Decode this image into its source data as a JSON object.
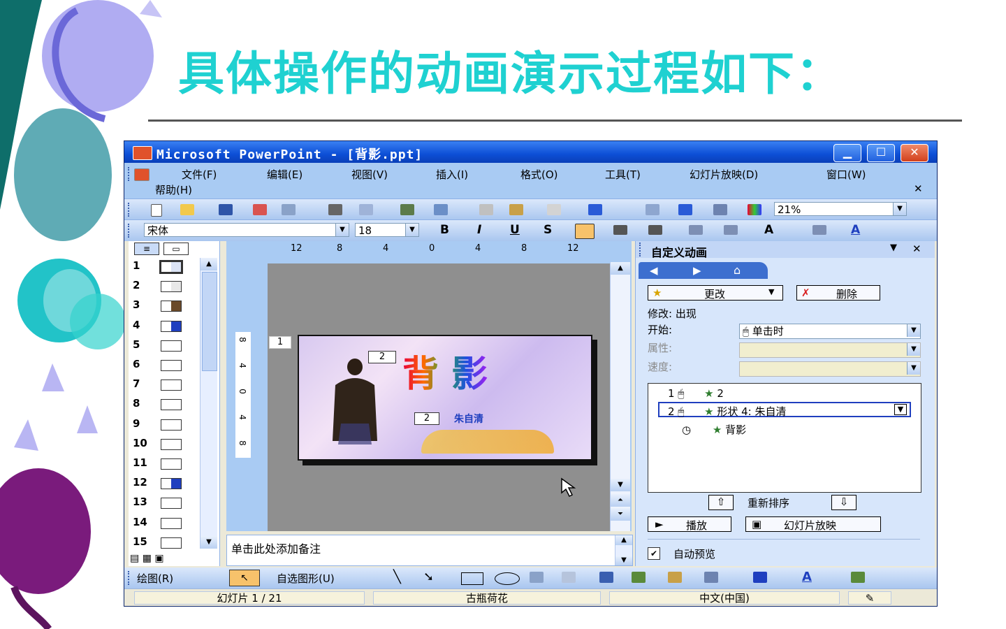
{
  "slide_title": "具体操作的动画演示过程如下：",
  "window": {
    "title": "Microsoft PowerPoint - [背影.ppt]",
    "min_glyph": "▁",
    "max_glyph": "☐",
    "close_glyph": "✕"
  },
  "menu": {
    "items": [
      "文件(F)",
      "编辑(E)",
      "视图(V)",
      "插入(I)",
      "格式(O)",
      "工具(T)",
      "幻灯片放映(D)",
      "窗口(W)"
    ],
    "help": "帮助(H)",
    "doc_close": "✕"
  },
  "toolbar_standard": {
    "zoom": "21%"
  },
  "toolbar_format": {
    "font": "宋体",
    "size": "18",
    "bold": "B",
    "italic": "I",
    "underline": "U",
    "shadow": "S",
    "font_grow": "A",
    "font_color": "A"
  },
  "outline_tabs": {
    "outline": "≡",
    "slides": "▭"
  },
  "slides": [
    "1",
    "2",
    "3",
    "4",
    "5",
    "6",
    "7",
    "8",
    "9",
    "10",
    "11",
    "12",
    "13",
    "14",
    "15"
  ],
  "ruler": {
    "h_ticks": [
      "12",
      "8",
      "4",
      "0",
      "4",
      "8",
      "12"
    ],
    "v_ticks": [
      "8",
      "4",
      "0",
      "4",
      "8"
    ]
  },
  "canvas": {
    "slide_number": "1",
    "tag_title": "2",
    "tag_subtitle": "2",
    "title_text": "背 影",
    "subtitle_text": "朱自清"
  },
  "notes_placeholder": "单击此处添加备注",
  "task_pane": {
    "title": "自定义动画",
    "change_btn": "更改",
    "delete_btn": "删除",
    "modify_label": "修改: 出现",
    "start_label": "开始:",
    "start_value": "单击时",
    "property_label": "属性:",
    "speed_label": "速度:",
    "anim_items": [
      {
        "num": "1",
        "text": "2"
      },
      {
        "num": "2",
        "text": "形状 4: 朱自清"
      },
      {
        "num": "",
        "text": "背影"
      }
    ],
    "reorder_label": "重新排序",
    "play_btn": "播放",
    "slideshow_btn": "幻灯片放映",
    "autopreview_label": "自动预览"
  },
  "drawing_toolbar": {
    "draw_menu": "绘图(R)",
    "autoshapes_menu": "自选图形(U)"
  },
  "status": {
    "slide_pos": "幻灯片 1 / 21",
    "design": "古瓶荷花",
    "language": "中文(中国)"
  },
  "colors": {
    "title_teal": "#1fd1d1",
    "xp_blue": "#0d4fd6",
    "pane_blue": "#a9cbf3"
  }
}
